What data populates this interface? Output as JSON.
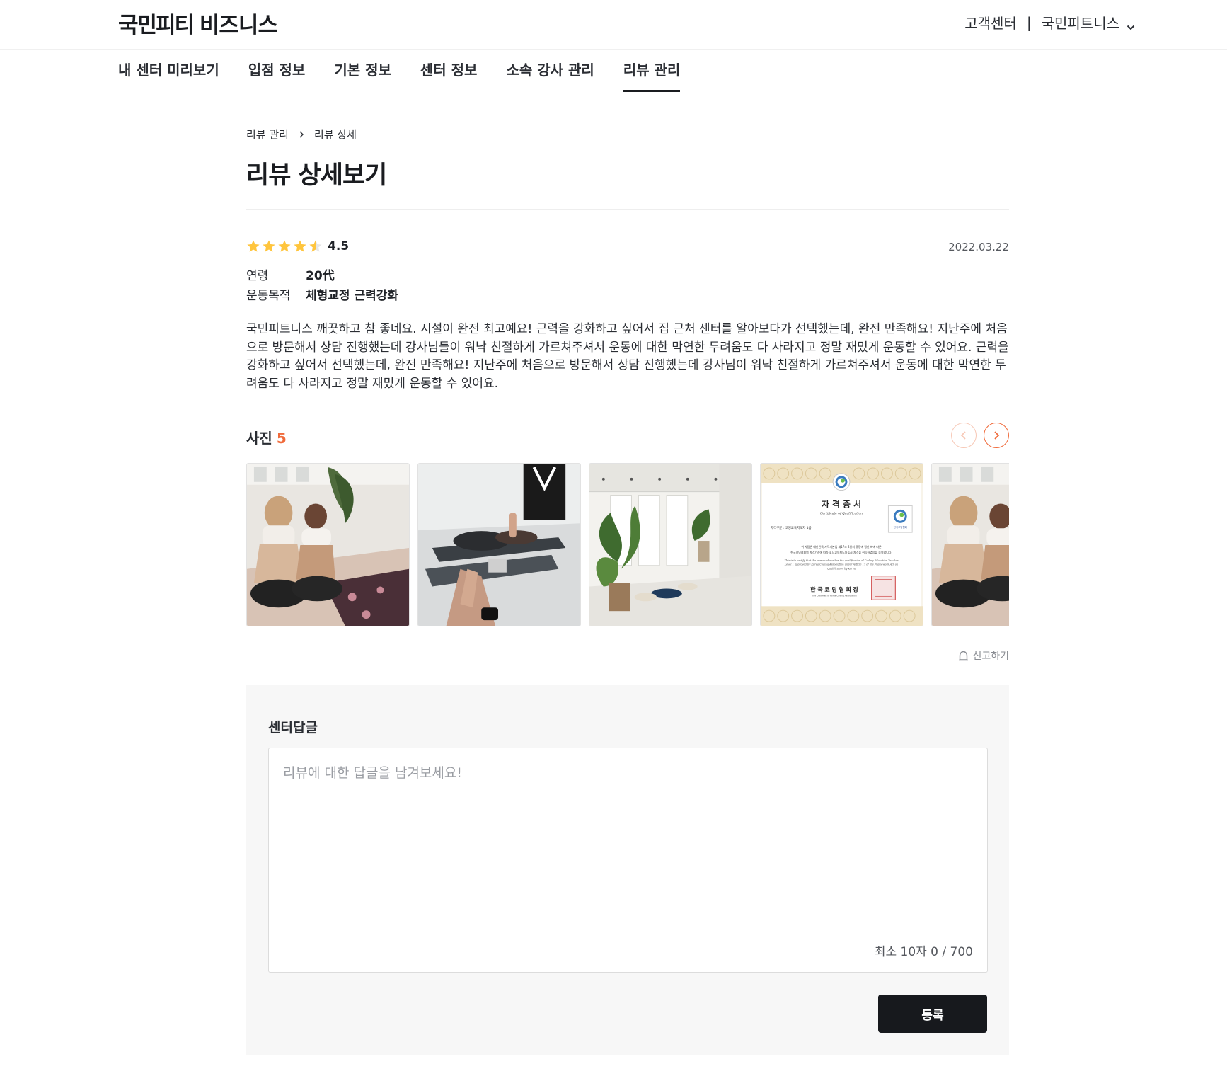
{
  "header": {
    "logo_main": "국민피티",
    "logo_sub": "비즈니스",
    "customer_center": "고객센터",
    "separator": "|",
    "account_name": "국민피트니스"
  },
  "nav": {
    "tabs": [
      {
        "label": "내 센터 미리보기",
        "active": false
      },
      {
        "label": "입점 정보",
        "active": false
      },
      {
        "label": "기본 정보",
        "active": false
      },
      {
        "label": "센터 정보",
        "active": false
      },
      {
        "label": "소속 강사 관리",
        "active": false
      },
      {
        "label": "리뷰 관리",
        "active": true
      }
    ]
  },
  "breadcrumb": {
    "parent": "리뷰 관리",
    "current": "리뷰 상세"
  },
  "page": {
    "title": "리뷰 상세보기"
  },
  "review": {
    "rating": 4.5,
    "rating_label": "4.5",
    "date": "2022.03.22",
    "meta": [
      {
        "key": "연령",
        "value": "20代"
      },
      {
        "key": "운동목적",
        "value": "체형교정 근력강화"
      }
    ],
    "body": "국민피트니스 깨끗하고 참 좋네요. 시설이 완전 최고예요! 근력을 강화하고 싶어서 집 근처 센터를 알아보다가 선택했는데, 완전 만족해요! 지난주에 처음으로 방문해서 상담 진행했는데 강사님들이 워낙 친절하게 가르쳐주셔서 운동에 대한 막연한 두려움도 다 사라지고 정말 재밌게 운동할 수 있어요. 근력을 강화하고 싶어서 선택했는데, 완전 만족해요! 지난주에 처음으로 방문해서 상담 진행했는데 강사님이 워낙 친절하게 가르쳐주셔서 운동에 대한 막연한 두려움도 다 사라지고 정말 재밌게 운동할 수 있어요."
  },
  "photos": {
    "label": "사진",
    "count": "5",
    "items": [
      {
        "name": "yoga-women-photo"
      },
      {
        "name": "stretching-class-photo"
      },
      {
        "name": "studio-interior-photo"
      },
      {
        "name": "certificate-photo"
      },
      {
        "name": "yoga-women-photo-2"
      }
    ],
    "certificate": {
      "title": "자 격 증 서",
      "subtitle": "Certificate of Qualification",
      "type_line": "자격구분 : 코딩교육지도자 1급",
      "body_line1": "위 사람은 대한민국 자격기본법 제17조 2항의 규정에 정한 바에 따른",
      "body_line2": "한국코딩협회의 자격기준에 따라 코딩교육지도자 1급 자격을 취득하였음을 증명합니다.",
      "en_line1": "This is to certify that the person above has the qualification of Coding Education Teacher",
      "en_line2": "Level 1 approved by Korea Coding Association under Article 17 of the Framework Act on",
      "en_line3": "Qualification by Korea",
      "issuer": "한 국 코 딩 협 회 장",
      "issuer_en": "The Chairman of Korea Coding Association",
      "badge": "한국코딩협회"
    }
  },
  "report": {
    "label": "신고하기"
  },
  "reply": {
    "label": "센터답글",
    "placeholder": "리뷰에 대한 답글을 남겨보세요!",
    "value": "",
    "counter": "최소 10자 0 / 700",
    "submit_label": "등록"
  },
  "colors": {
    "accent": "#f06a3a",
    "star": "#ffc53d",
    "dark_button": "#17191d"
  }
}
